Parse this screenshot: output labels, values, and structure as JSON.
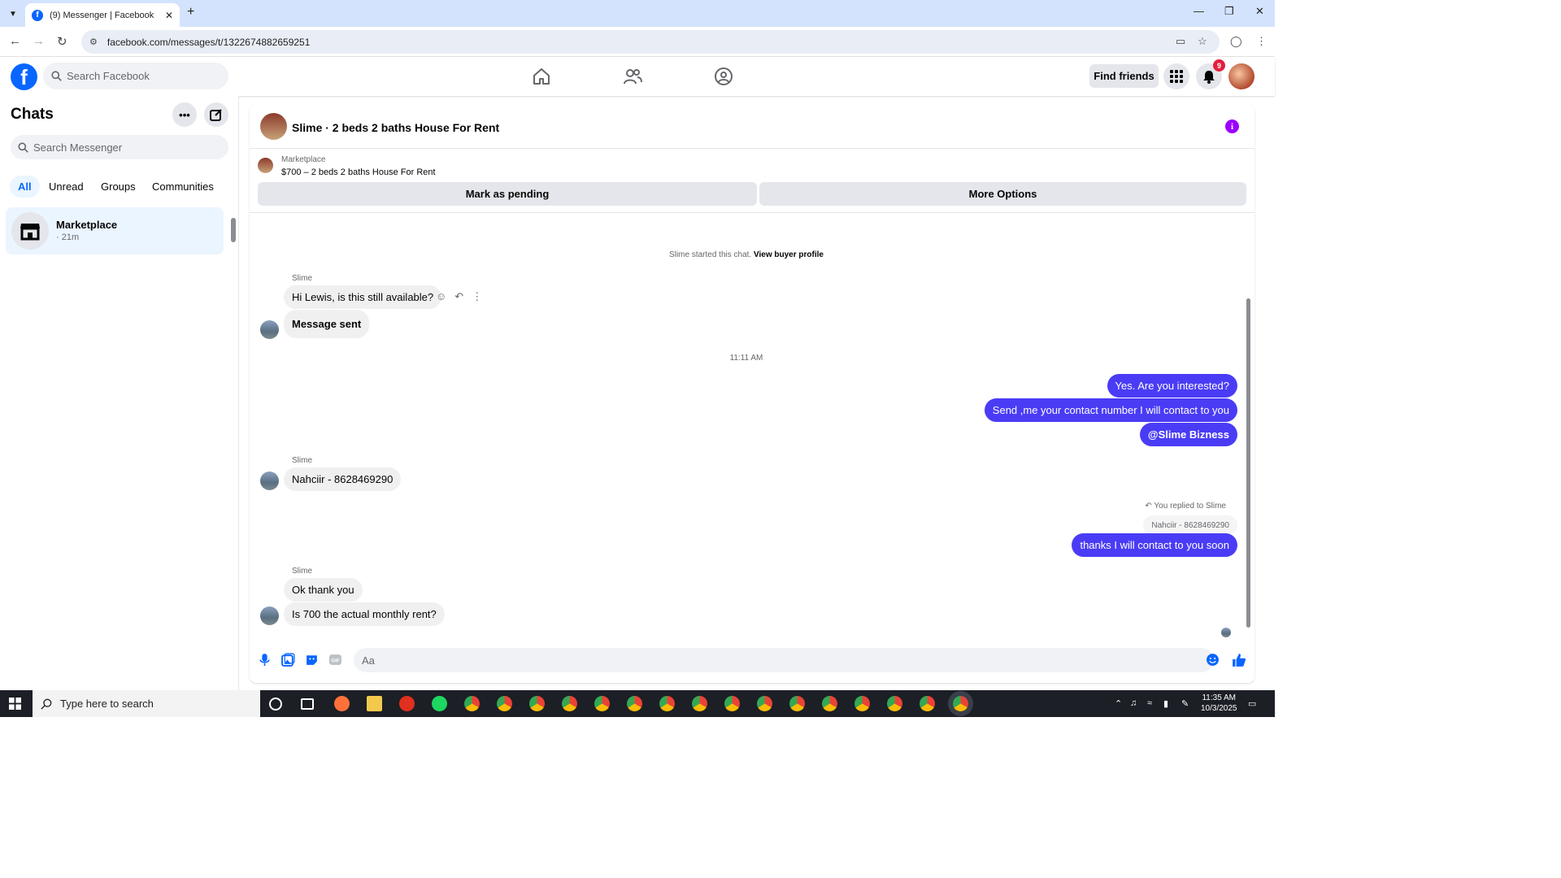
{
  "browser": {
    "tab_title": "(9) Messenger | Facebook",
    "url": "facebook.com/messages/t/1322674882659251"
  },
  "fb": {
    "search_placeholder": "Search Facebook",
    "find_friends": "Find friends",
    "notification_count": "9",
    "brand_color": "#0866ff"
  },
  "chats": {
    "title": "Chats",
    "search_placeholder": "Search Messenger",
    "filters": [
      "All",
      "Unread",
      "Groups",
      "Communities"
    ],
    "active_filter": "All",
    "items": [
      {
        "name": "Marketplace",
        "time": "· 21m"
      }
    ]
  },
  "conversation": {
    "title": "Slime · 2 beds 2 baths House For Rent",
    "marketplace": {
      "label": "Marketplace",
      "listing": "$700 – 2 beds 2 baths House For Rent",
      "mark_pending": "Mark as pending",
      "more_options": "More Options"
    },
    "started_text": "Slime started this chat.",
    "view_buyer_profile": "View buyer profile",
    "timestamp": "11:11 AM",
    "messages": {
      "sender1": "Slime",
      "m1": "Hi Lewis, is this still available?",
      "m2": "Message sent",
      "o1": "Yes. Are you interested?",
      "o2": "Send ,me your contact number I will contact to you",
      "o3": "@Slime Bizness",
      "sender2": "Slime",
      "m3": "Nahciir - 8628469290",
      "reply_note": "You replied to Slime",
      "reply_quote": "Nahciir - 8628469290",
      "o4": "thanks I will contact to you soon",
      "sender3": "Slime",
      "m4": "Ok thank you",
      "m5": "Is 700 the actual monthly rent?"
    },
    "composer_placeholder": "Aa",
    "outgoing_color": "#4a3cf5"
  },
  "taskbar": {
    "search_placeholder": "Type here to search",
    "time": "11:35 AM",
    "date": "10/3/2025"
  }
}
